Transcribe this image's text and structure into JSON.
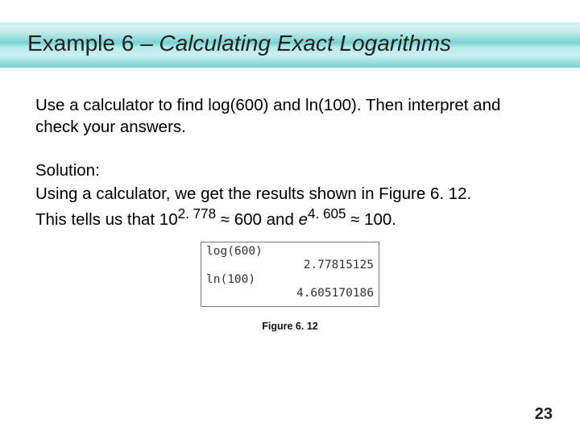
{
  "title": {
    "prefix": "Example 6 – ",
    "main": "Calculating Exact Logarithms"
  },
  "problem": "Use a calculator to find log(600) and ln(100). Then interpret and check your answers.",
  "solution": {
    "label": "Solution:",
    "line1": "Using a calculator, we get the results shown in Figure 6. 12.",
    "line2_prefix": "This tells us that 10",
    "exp1": "2. 778",
    "approx1": " ≈ 600 and ",
    "e": "e",
    "exp2": "4. 605",
    "approx2": " ≈ 100."
  },
  "calc": {
    "l1": "log(600)",
    "l2": "2.77815125",
    "l3": "ln(100)",
    "l4": "4.605170186"
  },
  "figure_caption": "Figure 6. 12",
  "page_number": "23"
}
